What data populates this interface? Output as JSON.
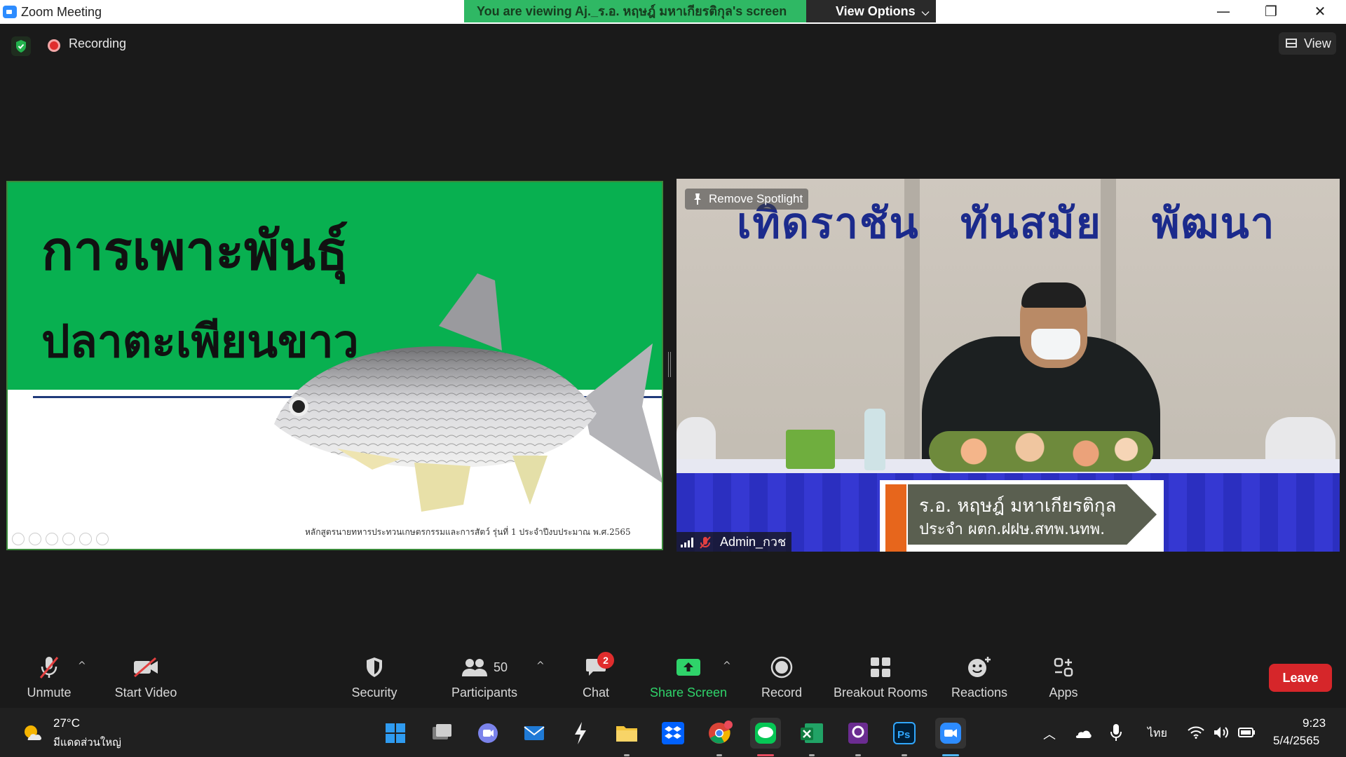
{
  "titlebar": {
    "app_title": "Zoom Meeting",
    "viewing_banner": "You are viewing Aj._ร.อ. หฤษฎ์ มหาเกียรติกุล's screen",
    "view_options": "View Options",
    "view_options_caret": "⌵",
    "minimize": "—",
    "restore": "❐",
    "close": "✕"
  },
  "header": {
    "recording_label": "Recording",
    "view_label": "View",
    "icons": [
      "shield-check-icon",
      "recording-icon",
      "grid-view-icon"
    ]
  },
  "shared_screen": {
    "slide_title": "การเพาะพันธุ์",
    "slide_subtitle": "ปลาตะเพียนขาว",
    "slide_footer": "หลักสูตรนายทหารประทวนเกษตรกรรมและการสัตว์ รุ่นที่ 1 ประจำปีงบประมาณ พ.ศ.2565",
    "colors": {
      "green": "#08b050",
      "line": "#1f3a7a"
    }
  },
  "video_tile": {
    "remove_spotlight": "Remove Spotlight",
    "banner_words": [
      "เทิดราชัน",
      "ทันสมัย",
      "พัฒนา"
    ],
    "nameplate_line1": "ร.อ. หฤษฎ์ มหาเกียรติกุล",
    "nameplate_line2": "ประจำ ผตก.ฝฝษ.สทพ.นทพ.",
    "participant_name": "Admin_กวช"
  },
  "toolbar": {
    "unmute": "Unmute",
    "start_video": "Start Video",
    "security": "Security",
    "participants": "Participants",
    "participants_count": "50",
    "chat": "Chat",
    "chat_badge": "2",
    "share_screen": "Share Screen",
    "record": "Record",
    "breakout_rooms": "Breakout Rooms",
    "reactions": "Reactions",
    "apps": "Apps",
    "leave": "Leave",
    "caret": "^"
  },
  "taskbar": {
    "weather_temp": "27°C",
    "weather_desc": "มีแดดส่วนใหญ่",
    "apps": [
      "windows-start-icon",
      "task-view-icon",
      "teams-chat-icon",
      "mail-icon",
      "winamp-icon",
      "file-explorer-icon",
      "dropbox-icon",
      "chrome-icon",
      "line-icon",
      "excel-icon",
      "pdf-app-icon",
      "photoshop-icon",
      "zoom-icon"
    ],
    "language": "ไทย",
    "time": "9:23",
    "date": "5/4/2565"
  }
}
